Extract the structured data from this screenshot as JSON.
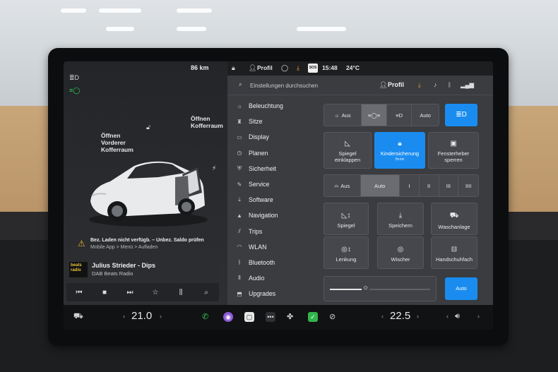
{
  "status": {
    "range": "86 km",
    "profile": "Profil",
    "time": "15:48",
    "temperature": "24°C",
    "sos": "SOS"
  },
  "car_panel": {
    "front_trunk": "Öffnen\nVorderer\nKofferraum",
    "rear_trunk": "Öffnen\nKofferraum",
    "alert_line1": "Bez. Laden nicht verfügb. – Unbez. Saldo prüfen",
    "alert_line2": "Mobile App > Menü > Aufladen"
  },
  "media": {
    "logo": "beats radio",
    "title": "Julius Strieder - Dips",
    "station": "DAB Beats Radio"
  },
  "settings": {
    "search_placeholder": "Einstellungen durchsuchen",
    "profile": "Profil",
    "nav": [
      {
        "icon": "light-icon",
        "label": "Beleuchtung"
      },
      {
        "icon": "seat-icon",
        "label": "Sitze"
      },
      {
        "icon": "display-icon",
        "label": "Display"
      },
      {
        "icon": "schedule-icon",
        "label": "Planen"
      },
      {
        "icon": "lock-icon",
        "label": "Sicherheit"
      },
      {
        "icon": "wrench-icon",
        "label": "Service"
      },
      {
        "icon": "download-icon",
        "label": "Software"
      },
      {
        "icon": "navigation-icon",
        "label": "Navigation"
      },
      {
        "icon": "trips-icon",
        "label": "Trips"
      },
      {
        "icon": "wifi-icon",
        "label": "WLAN"
      },
      {
        "icon": "bluetooth-icon",
        "label": "Bluetooth"
      },
      {
        "icon": "audio-icon",
        "label": "Audio"
      },
      {
        "icon": "upgrades-icon",
        "label": "Upgrades"
      }
    ],
    "lights": {
      "off": "Aus",
      "auto": "Auto",
      "selected": "parking-lights"
    },
    "tiles_row2": {
      "mirror_fold": "Spiegel\neinklappen",
      "child_lock": "Kindersicherung",
      "child_lock_sub": "Beide",
      "window_lock": "Fensterheber\nsperren"
    },
    "wipers": {
      "off": "Aus",
      "auto": "Auto",
      "speeds": [
        "I",
        "II",
        "III",
        "IIII"
      ],
      "selected": "Auto"
    },
    "tiles_grid": {
      "mirrors": "Spiegel",
      "save": "Speichern",
      "car_wash": "Waschanlage",
      "steering": "Lenkung",
      "wipers": "Wischer",
      "glovebox": "Handschuhfach"
    },
    "brightness": {
      "level": 0.3,
      "auto": "Auto"
    }
  },
  "bottom": {
    "driver_temp": "21.0",
    "passenger_temp": "22.5",
    "volume_icon": "volume-icon"
  },
  "colors": {
    "accent": "#1a8cf0",
    "warning": "#f0b429",
    "charge_green": "#2fd45c"
  }
}
